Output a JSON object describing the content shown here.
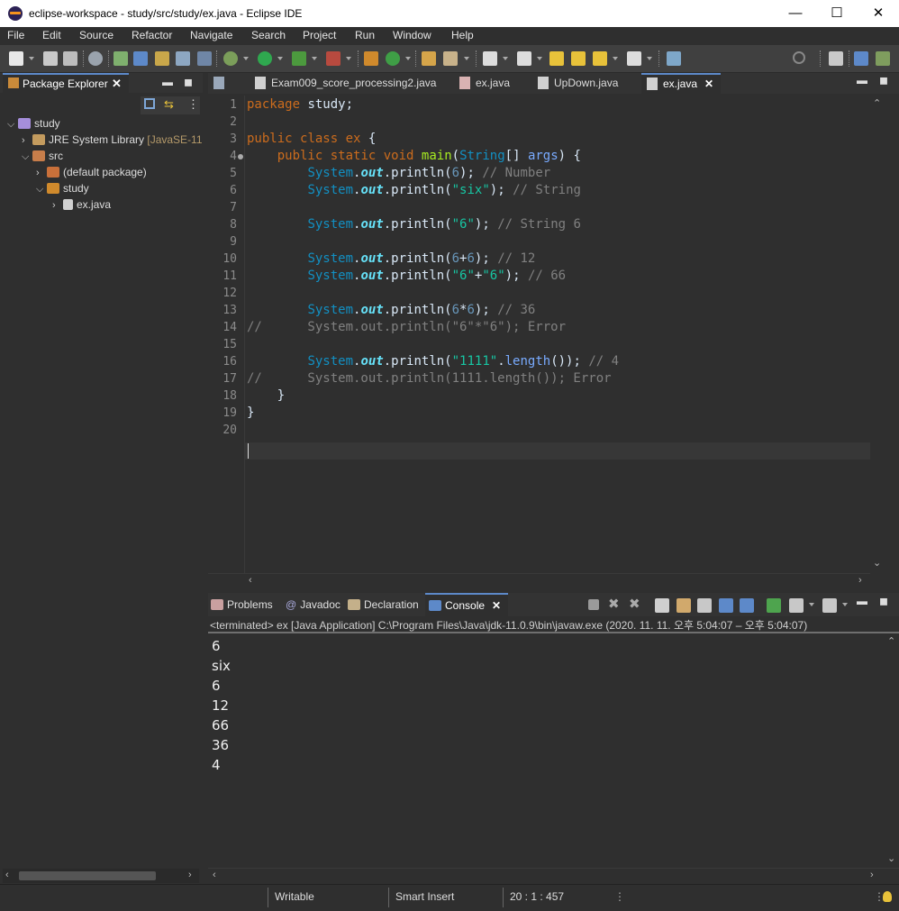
{
  "window": {
    "title": "eclipse-workspace - study/src/study/ex.java - Eclipse IDE",
    "minimize": "—",
    "maximize": "☐",
    "close": "✕"
  },
  "menu": [
    "File",
    "Edit",
    "Source",
    "Refactor",
    "Navigate",
    "Search",
    "Project",
    "Run",
    "Window",
    "Help"
  ],
  "package_explorer": {
    "tab_label": "Package Explorer",
    "tree": [
      {
        "label": "study",
        "depth": 0,
        "expanded": true,
        "icon": "project-icon"
      },
      {
        "label": "JRE System Library",
        "suffix": "[JavaSE-11",
        "depth": 1,
        "expanded": false,
        "icon": "library-icon"
      },
      {
        "label": "src",
        "depth": 1,
        "expanded": true,
        "icon": "source-folder-icon"
      },
      {
        "label": "(default package)",
        "depth": 2,
        "expanded": false,
        "icon": "package-icon"
      },
      {
        "label": "study",
        "depth": 2,
        "expanded": true,
        "icon": "package-icon"
      },
      {
        "label": "ex.java",
        "depth": 3,
        "expanded": false,
        "icon": "java-file-icon"
      }
    ]
  },
  "editor": {
    "tabs": [
      {
        "label": "Exam009_score_processing2.java",
        "active": false
      },
      {
        "label": "ex.java",
        "active": false
      },
      {
        "label": "UpDown.java",
        "active": false
      },
      {
        "label": "ex.java",
        "active": true
      }
    ],
    "line_numbers": [
      "1",
      "2",
      "3",
      "4",
      "5",
      "6",
      "7",
      "8",
      "9",
      "10",
      "11",
      "12",
      "13",
      "14",
      "15",
      "16",
      "17",
      "18",
      "19",
      "20"
    ]
  },
  "console": {
    "tabs": [
      "Problems",
      "Javadoc",
      "Declaration",
      "Console"
    ],
    "active_tab": "Console",
    "status": "<terminated> ex [Java Application] C:\\Program Files\\Java\\jdk-11.0.9\\bin\\javaw.exe  (2020. 11. 11. 오후 5:04:07 – 오후 5:04:07)",
    "output": [
      "6",
      "six",
      "6",
      "12",
      "66",
      "36",
      "4"
    ]
  },
  "statusbar": {
    "writable": "Writable",
    "insert_mode": "Smart Insert",
    "position": "20 : 1 : 457"
  },
  "colors": {
    "accent": "#5d89c9",
    "keyword": "#cc6c1d",
    "string": "#17c6a3",
    "comment": "#808080"
  }
}
